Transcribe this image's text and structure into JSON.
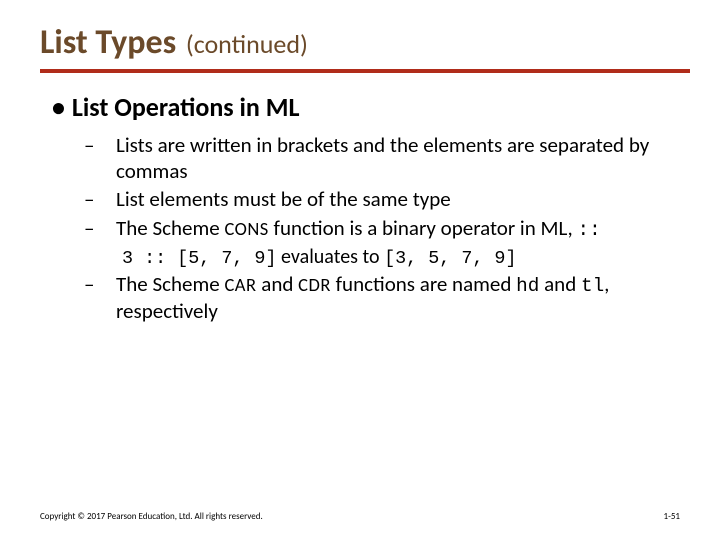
{
  "title": {
    "main": "List Types",
    "sub": "(continued)"
  },
  "heading": "List Operations in ML",
  "items": [
    {
      "text": "Lists are written in brackets and the elements are separated by commas"
    },
    {
      "text": "List elements must be of the same type"
    },
    {
      "pre": "The Scheme ",
      "cons": "CONS",
      "mid": " function is a binary operator in ML, ",
      "op": "::",
      "example": {
        "lhs": "3 :: [5, 7, 9]",
        "verb": " evaluates to ",
        "rhs": "[3, 5, 7, 9]"
      }
    },
    {
      "pre": "The Scheme ",
      "car": "CAR",
      "and1": " and ",
      "cdr": "CDR",
      "mid": " functions are named ",
      "hd": "hd",
      "and2": " and ",
      "tl": "tl",
      "post": ", respectively"
    }
  ],
  "footer": {
    "copyright": "Copyright © 2017 Pearson Education, Ltd. All rights reserved.",
    "page": "1-51"
  }
}
